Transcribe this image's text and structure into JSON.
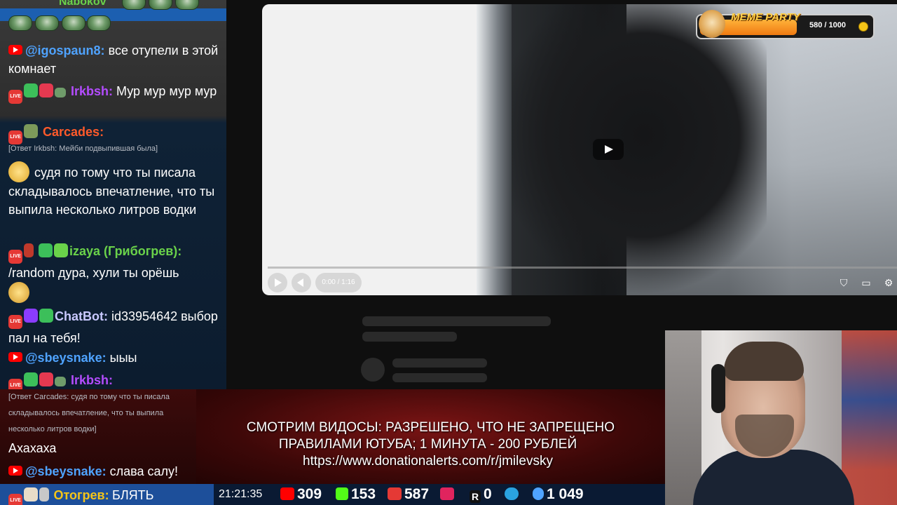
{
  "chat": {
    "top_nick": "Nabokov",
    "messages": [
      {
        "nick": "@igospaun8:",
        "text": "все отупели в этой комнает",
        "nick_color": "#4fa3ff"
      },
      {
        "nick": "Irkbsh:",
        "text": "Мур мур мур мур",
        "nick_color": "#b44cff"
      },
      {
        "nick": "Carcades:",
        "text": "",
        "nick_color": "#ff5a2a"
      },
      {
        "reply": "[Ответ Irkbsh: Мейби подвыпившая была]"
      },
      {
        "text": "судя по тому что ты писала складывалось впечатление, что ты выпила несколько литров водки"
      },
      {
        "nick": "izaya (Грибогрев):",
        "text": "/random дура, хули ты орёшь",
        "nick_color": "#6ad24a"
      },
      {
        "nick": "ChatBot:",
        "text": "id33954642 выбор пал на тебя!",
        "nick_color": "#c9c9ff"
      },
      {
        "nick": "@sbeysnake:",
        "text": "ыыы",
        "nick_color": "#4fa3ff"
      },
      {
        "nick": "Irkbsh:",
        "text": "",
        "nick_color": "#b44cff"
      },
      {
        "reply": "[Ответ Carcades: судя по тому что ты писала складывалось впечатление, что ты выпила несколько литров водки]"
      },
      {
        "text": "Ахахаха"
      },
      {
        "nick": "@sbeysnake:",
        "text": "слава салу!",
        "nick_color": "#4fa3ff"
      },
      {
        "nick": "Отогрев:",
        "text": "БЛЯТЬ",
        "nick_color": "#f5c518"
      }
    ]
  },
  "video": {
    "time": "0:00 / 1:16"
  },
  "meme_party": {
    "title": "MEME PARTY",
    "count": "580 / 1000"
  },
  "banner": {
    "line1": "СМОТРИМ ВИДОСЫ: РАЗРЕШЕНО, ЧТО НЕ ЗАПРЕЩЕНО",
    "line2": "ПРАВИЛАМИ ЮТУБА; 1 МИНУТА - 200 РУБЛЕЙ",
    "line3": "https://www.donationalerts.com/r/jmilevsky"
  },
  "status": {
    "clock": "21:21:35",
    "youtube": "309",
    "kick": "153",
    "vk_live": "587",
    "rutube_play": "",
    "rumble": "0",
    "telegram": "",
    "viewers": "1 049"
  },
  "colors": {
    "accent_blue": "#1d4f9a",
    "banner_red": "#7a1414",
    "youtube_red": "#ff0000",
    "kick_green": "#53fc18"
  }
}
